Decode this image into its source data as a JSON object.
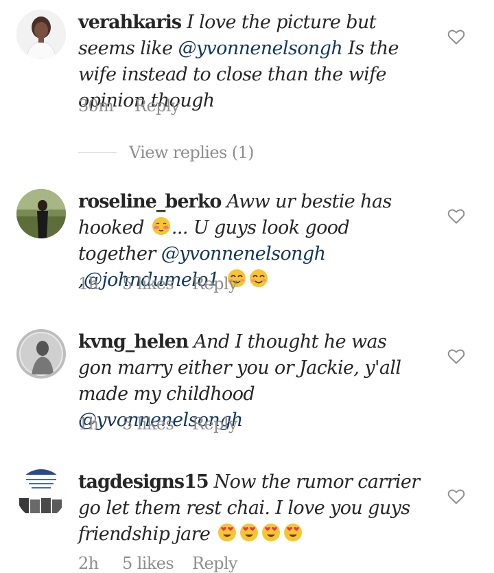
{
  "comments": [
    {
      "username": "verahkaris",
      "text_1": "I love the picture but seems like",
      "mention_1": "@yvonnenelsongh",
      "text_2": " Is the wife instead to close than the wife opinion though",
      "time": "30m",
      "likes": "",
      "reply": "Reply",
      "heart_icon": "heart-outline-icon"
    },
    {
      "username": "roseline_berko",
      "text_1": "Aww ur bestie has hooked",
      "text_2": "... U guys look good together",
      "mention_1": "@yvonnenelsongh",
      "text_3": " ,",
      "mention_2": "@johndumelo1",
      "time": "1h",
      "likes": "5 likes",
      "reply": "Reply",
      "heart_icon": "heart-outline-icon"
    },
    {
      "username": "kvng_helen",
      "text_1": "And I thought he was gon marry either you or Jackie, y'all made my childhood",
      "mention_1": "@yvonnenelsongh",
      "time": "1h",
      "likes": "5 likes",
      "reply": "Reply",
      "heart_icon": "heart-outline-icon"
    },
    {
      "username": "tagdesigns15",
      "text_1": "Now the rumor carrier go let them rest chai. I love you guys friendship jare",
      "time": "2h",
      "likes": "5 likes",
      "reply": "Reply",
      "heart_icon": "heart-outline-icon"
    }
  ],
  "view_replies": "View replies (1)",
  "colors": {
    "mention": "#12375f",
    "meta": "#8e8e8e",
    "text": "#262626",
    "emoji": "#f7c531"
  }
}
